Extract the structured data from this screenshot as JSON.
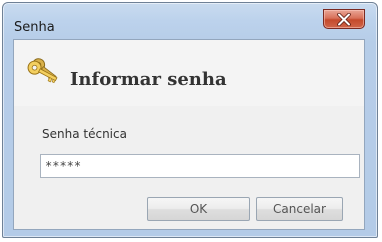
{
  "window": {
    "title": "Senha",
    "close_icon": "close-x-icon"
  },
  "dialog": {
    "icon": "keys-icon",
    "heading": "Informar senha",
    "field_label": "Senha técnica",
    "field_value": "*****",
    "ok_label": "OK",
    "cancel_label": "Cancelar"
  },
  "colors": {
    "title_bar": "#bcd2ec",
    "close_button": "#c44a2c",
    "client_background": "#f0f0f0"
  }
}
